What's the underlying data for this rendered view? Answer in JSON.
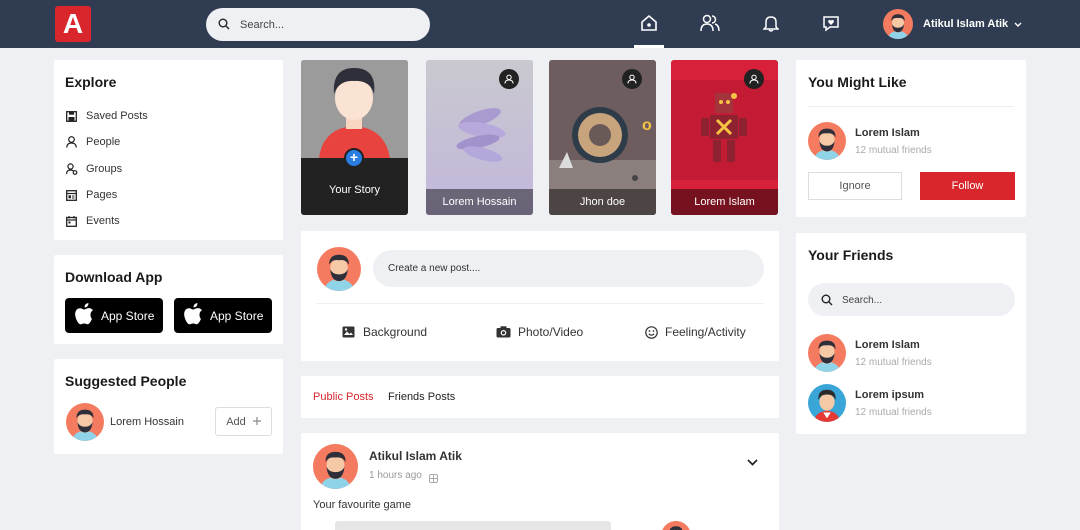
{
  "header": {
    "logo_letter": "A",
    "search_placeholder": "Search...",
    "user_name": "Atikul Islam Atik"
  },
  "explore": {
    "title": "Explore",
    "items": [
      {
        "label": "Saved Posts",
        "icon": "save-icon"
      },
      {
        "label": "People",
        "icon": "person-icon"
      },
      {
        "label": "Groups",
        "icon": "group-icon"
      },
      {
        "label": "Pages",
        "icon": "page-icon"
      },
      {
        "label": "Events",
        "icon": "calendar-icon"
      }
    ]
  },
  "download": {
    "title": "Download App",
    "buttons": [
      "App Store",
      "App Store"
    ]
  },
  "suggested": {
    "title": "Suggested People",
    "person_name": "Lorem Hossain",
    "add_label": "Add"
  },
  "stories": {
    "own_label": "Your Story",
    "items": [
      {
        "name": "Lorem Hossain"
      },
      {
        "name": "Jhon doe"
      },
      {
        "name": "Lorem Islam"
      }
    ]
  },
  "create_post": {
    "placeholder": "Create a new post....",
    "actions": [
      "Background",
      "Photo/Video",
      "Feeling/Activity"
    ]
  },
  "feed_tabs": {
    "public": "Public Posts",
    "friends": "Friends Posts"
  },
  "post": {
    "author": "Atikul Islam Atik",
    "time": "1 hours ago",
    "text": "Your favourite game"
  },
  "might_like": {
    "title": "You Might Like",
    "name": "Lorem Islam",
    "mutual": "12 mutual friends",
    "ignore_label": "Ignore",
    "follow_label": "Follow"
  },
  "friends": {
    "title": "Your Friends",
    "search_placeholder": "Search...",
    "list": [
      {
        "name": "Lorem Islam",
        "mutual": "12 mutual friends"
      },
      {
        "name": "Lorem ipsum",
        "mutual": "12 mutual friends"
      }
    ]
  },
  "colors": {
    "topbar": "#2f3c52",
    "accent": "#d9262d",
    "story_blue": "#2a7de1"
  }
}
